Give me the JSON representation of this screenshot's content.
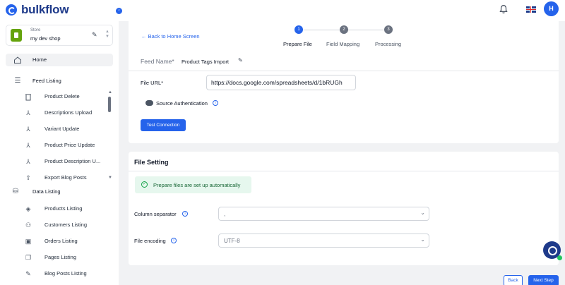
{
  "app": {
    "name": "bulkflow",
    "user_initial": "H"
  },
  "store": {
    "label": "Store",
    "name": "my dev shop"
  },
  "sidebar": {
    "home": "Home",
    "feed_listing": "Feed Listing",
    "feed_items": [
      "Product Delete",
      "Descriptions Upload",
      "Variant Update",
      "Product Price Update",
      "Product Description U...",
      "Export Blog Posts"
    ],
    "data_listing": "Data Listing",
    "data_items": [
      "Products Listing",
      "Customers Listing",
      "Orders Listing",
      "Pages Listing",
      "Blog Posts Listing"
    ]
  },
  "header": {
    "back_link": "Back to Home Screen",
    "steps": [
      {
        "num": "1",
        "label": "Prepare File"
      },
      {
        "num": "2",
        "label": "Field Mapping"
      },
      {
        "num": "3",
        "label": "Processing"
      }
    ]
  },
  "feed": {
    "name_label": "Feed Name*",
    "name_value": "Product Tags Import",
    "file_url_label": "File URL*",
    "file_url_value": "https://docs.google.com/spreadsheets/d/1bRUGh",
    "source_auth_label": "Source Authentication",
    "test_button": "Test Connection"
  },
  "file_setting": {
    "title": "File Setting",
    "notice": "Prepare files are set up automatically",
    "column_separator_label": "Column separator",
    "column_separator_value": ",",
    "file_encoding_label": "File encoding",
    "file_encoding_value": "UTF-8"
  },
  "footer": {
    "back_button": "Back",
    "next_button": "Next Step"
  },
  "colors": {
    "primary": "#2563eb",
    "success": "#16a34a"
  }
}
